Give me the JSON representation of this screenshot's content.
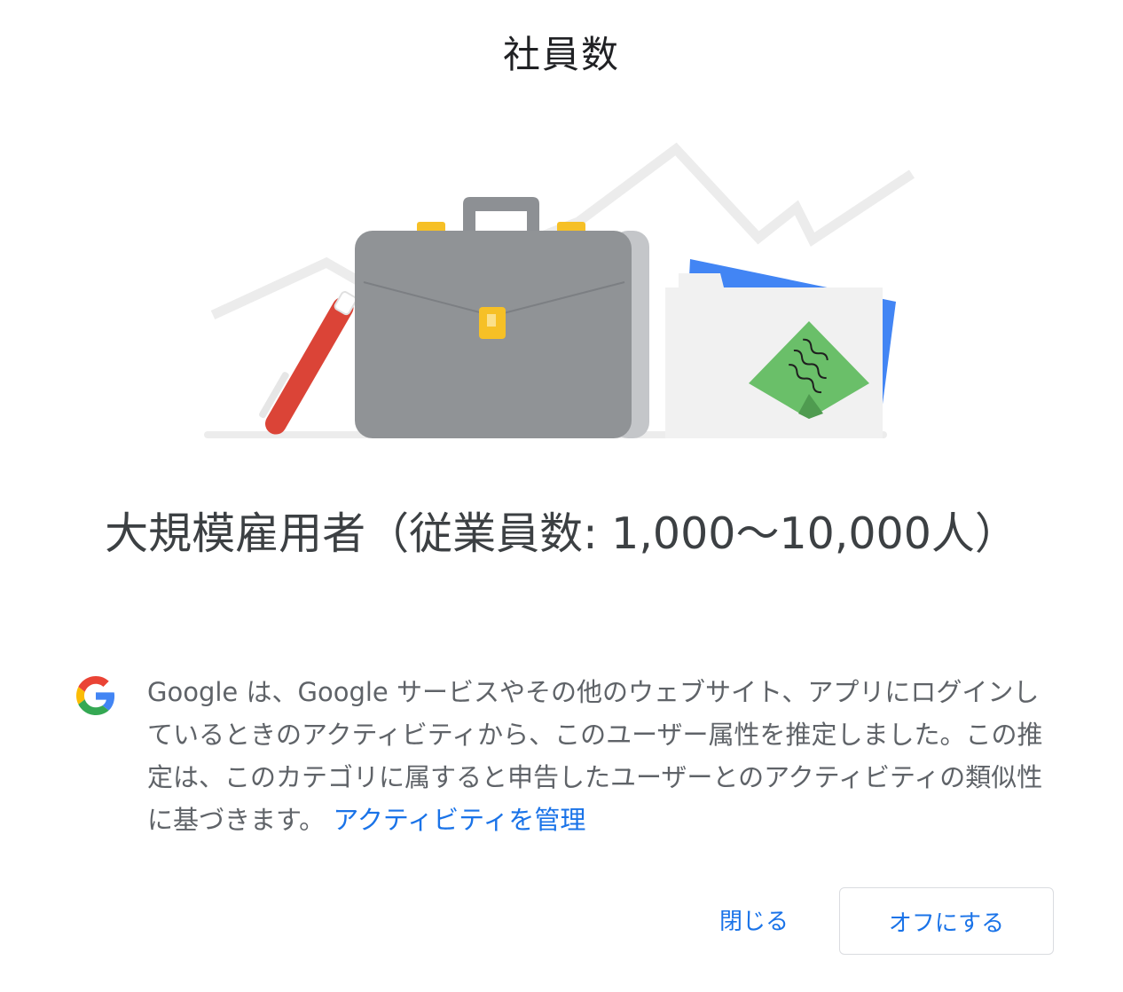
{
  "dialog": {
    "title": "社員数",
    "headline": "大規模雇用者（従業員数: 1,000〜10,000人）",
    "description": "Google は、Google サービスやその他のウェブサイト、アプリにログインしているときのアクティビティから、このユーザー属性を推定しました。この推定は、このカテゴリに属すると申告したユーザーとのアクティビティの類似性に基づきます。",
    "manage_link": "アクティビティを管理",
    "close_label": "閉じる",
    "turn_off_label": "オフにする"
  },
  "icons": {
    "provider_logo": "google-g-icon",
    "illustration": "briefcase-folder-illustration"
  },
  "colors": {
    "link": "#1a73e8",
    "title": "#202124",
    "body": "#5f6368",
    "briefcase": "#909396",
    "pen": "#db4437",
    "note": "#6abf69",
    "folder_back": "#4285f4",
    "clasp": "#f6c026"
  }
}
